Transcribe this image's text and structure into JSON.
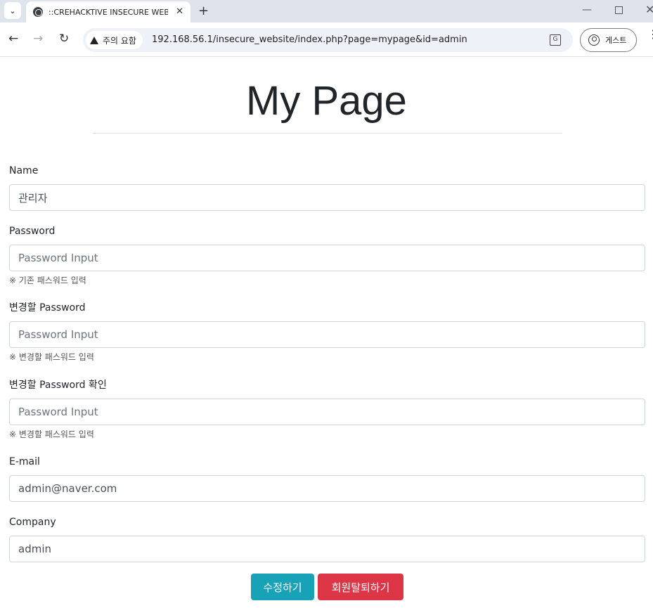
{
  "browser": {
    "tab_title": "::CREHACKTIVE INSECURE WEBSITE",
    "security_chip": "주의 요함",
    "url": "192.168.56.1/insecure_website/index.php?page=mypage&id=admin",
    "profile_label": "게스트",
    "icons": [
      "tab-search-icon",
      "globe-icon",
      "close-icon",
      "plus-icon",
      "minimize-icon",
      "maximize-icon",
      "window-close-icon",
      "back-arrow-icon",
      "forward-arrow-icon",
      "reload-icon",
      "warning-icon",
      "translate-icon",
      "profile-icon",
      "kebab-menu-icon"
    ]
  },
  "page": {
    "title": "My Page"
  },
  "form": {
    "name": {
      "label": "Name",
      "value": "관리자"
    },
    "password": {
      "label": "Password",
      "placeholder": "Password Input",
      "help": "※ 기존 패스워드 입력"
    },
    "new_password": {
      "label": "변경할 Password",
      "placeholder": "Password Input",
      "help": "※ 변경할 패스워드 입력"
    },
    "new_password_confirm": {
      "label": "변경할 Password 확인",
      "placeholder": "Password Input",
      "help": "※ 변경할 패스워드 입력"
    },
    "email": {
      "label": "E-mail",
      "value": "admin@naver.com"
    },
    "company": {
      "label": "Company",
      "value": "admin"
    }
  },
  "actions": {
    "edit_label": "수정하기",
    "withdraw_label": "회원탈퇴하기"
  },
  "colors": {
    "edit_button": "#17a2b8",
    "withdraw_button": "#dc3545",
    "tabstrip": "#dfe3eb"
  }
}
